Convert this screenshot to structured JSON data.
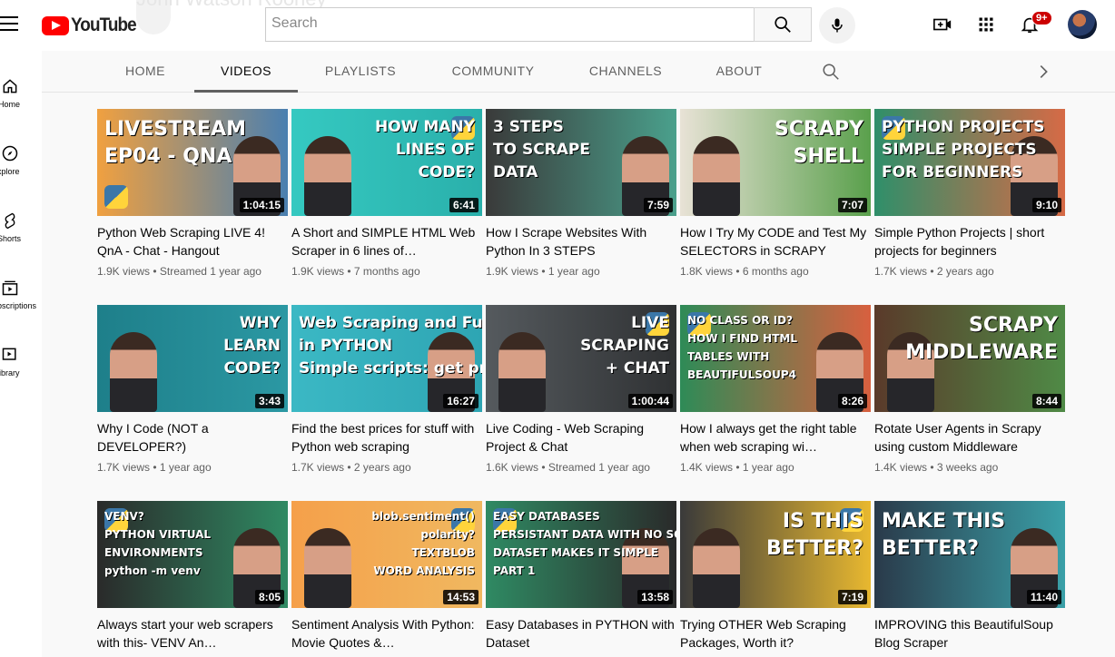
{
  "brand": {
    "logo_text": "YouTube",
    "ghost_channel": "John Watson Rooney"
  },
  "search": {
    "placeholder": "Search"
  },
  "notifications": {
    "badge": "9+"
  },
  "sidebar": {
    "items": [
      {
        "label": "Home",
        "icon": "home-icon"
      },
      {
        "label": "Explore",
        "icon": "compass-icon"
      },
      {
        "label": "Shorts",
        "icon": "shorts-icon"
      },
      {
        "label": "Subscriptions",
        "icon": "subscriptions-icon"
      },
      {
        "label": "Library",
        "icon": "library-icon"
      }
    ]
  },
  "tabs": [
    {
      "label": "HOME"
    },
    {
      "label": "VIDEOS"
    },
    {
      "label": "PLAYLISTS"
    },
    {
      "label": "COMMUNITY"
    },
    {
      "label": "CHANNELS"
    },
    {
      "label": "ABOUT"
    }
  ],
  "active_tab": "VIDEOS",
  "videos": [
    {
      "title": "Python Web Scraping LIVE 4! QnA - Chat - Hangout",
      "views": "1.9K views",
      "age": "Streamed 1 year ago",
      "duration": "1:04:15",
      "thumb_lines": [
        "LIVESTREAM",
        "EP04 - QNA"
      ],
      "bg": [
        "#f0a040",
        "#4a7fb0"
      ]
    },
    {
      "title": "A Short and SIMPLE HTML Web Scraper in 6 lines of…",
      "views": "1.9K views",
      "age": "7 months ago",
      "duration": "6:41",
      "thumb_lines": [
        "HOW MANY",
        "LINES OF",
        "CODE?"
      ],
      "bg": [
        "#35c9c1",
        "#2ab0ab"
      ]
    },
    {
      "title": "How I Scrape Websites With Python In 3 STEPS",
      "views": "1.9K views",
      "age": "1 year ago",
      "duration": "7:59",
      "thumb_lines": [
        "3 STEPS",
        "TO SCRAPE",
        "DATA"
      ],
      "bg": [
        "#3a3a3a",
        "#4aa08c"
      ]
    },
    {
      "title": "How I Try My CODE and Test My SELECTORS in SCRAPY",
      "views": "1.8K views",
      "age": "6 months ago",
      "duration": "7:07",
      "thumb_lines": [
        "SCRAPY",
        "SHELL"
      ],
      "bg": [
        "#e8e2d6",
        "#5aa04c"
      ]
    },
    {
      "title": "Simple Python Projects | short projects for beginners",
      "views": "1.7K views",
      "age": "2 years ago",
      "duration": "9:10",
      "thumb_lines": [
        "PYTHON PROJECTS",
        "SIMPLE PROJECTS",
        "FOR BEGINNERS"
      ],
      "bg": [
        "#2f8f6a",
        "#d66a46"
      ]
    },
    {
      "title": "Why I Code (NOT a DEVELOPER?)",
      "views": "1.7K views",
      "age": "1 year ago",
      "duration": "3:43",
      "thumb_lines": [
        "WHY",
        "LEARN",
        "CODE?"
      ],
      "bg": [
        "#1e7f8a",
        "#2b98a3"
      ]
    },
    {
      "title": "Find the best prices for stuff with Python web scraping",
      "views": "1.7K views",
      "age": "2 years ago",
      "duration": "16:27",
      "thumb_lines": [
        "Web Scraping and Functions",
        "in PYTHON",
        "Simple scripts: get prices and email"
      ],
      "bg": [
        "#3bb8c4",
        "#2ea5b3"
      ]
    },
    {
      "title": "Live Coding - Web Scraping Project & Chat",
      "views": "1.6K views",
      "age": "Streamed 1 year ago",
      "duration": "1:00:44",
      "thumb_lines": [
        "LIVE",
        "SCRAPING",
        "+ CHAT"
      ],
      "bg": [
        "#555a5e",
        "#2f3133"
      ]
    },
    {
      "title": "How I always get the right table when web scraping wi…",
      "views": "1.4K views",
      "age": "1 year ago",
      "duration": "8:26",
      "thumb_lines": [
        "NO CLASS OR ID?",
        "HOW I FIND HTML",
        "TABLES WITH",
        "BEAUTIFULSOUP4"
      ],
      "bg": [
        "#2e8b57",
        "#d8603f"
      ]
    },
    {
      "title": "Rotate User Agents in Scrapy using custom Middleware",
      "views": "1.4K views",
      "age": "3 weeks ago",
      "duration": "8:44",
      "thumb_lines": [
        "SCRAPY",
        "MIDDLEWARE"
      ],
      "bg": [
        "#5a3a2a",
        "#4f8a46"
      ]
    },
    {
      "title": "Always start your web scrapers with this- VENV An…",
      "views": "",
      "age": "",
      "duration": "8:05",
      "thumb_lines": [
        "VENV?",
        "PYTHON VIRTUAL",
        "ENVIRONMENTS",
        "python -m venv"
      ],
      "bg": [
        "#2a2a2a",
        "#2f8a63"
      ]
    },
    {
      "title": "Sentiment Analysis With Python: Movie Quotes &…",
      "views": "",
      "age": "",
      "duration": "14:53",
      "thumb_lines": [
        "blob.sentiment()",
        "polarity?",
        "TEXTBLOB",
        "WORD ANALYSIS"
      ],
      "bg": [
        "#f5a04a",
        "#f0b860"
      ]
    },
    {
      "title": "Easy Databases in PYTHON with Dataset",
      "views": "",
      "age": "",
      "duration": "13:58",
      "thumb_lines": [
        "EASY DATABASES",
        "PERSISTANT DATA WITH NO SQL",
        "DATASET MAKES IT SIMPLE",
        "PART 1"
      ],
      "bg": [
        "#2f8a63",
        "#2a2a2a"
      ]
    },
    {
      "title": "Trying OTHER Web Scraping Packages, Worth it?",
      "views": "",
      "age": "",
      "duration": "7:19",
      "thumb_lines": [
        "IS THIS",
        "BETTER?"
      ],
      "bg": [
        "#3a3a3a",
        "#e8b830"
      ]
    },
    {
      "title": "IMPROVING this BeautifulSoup Blog Scraper",
      "views": "",
      "age": "",
      "duration": "11:40",
      "thumb_lines": [
        "MAKE THIS",
        "BETTER?"
      ],
      "bg": [
        "#2a3a4a",
        "#3aa0a8"
      ]
    }
  ]
}
